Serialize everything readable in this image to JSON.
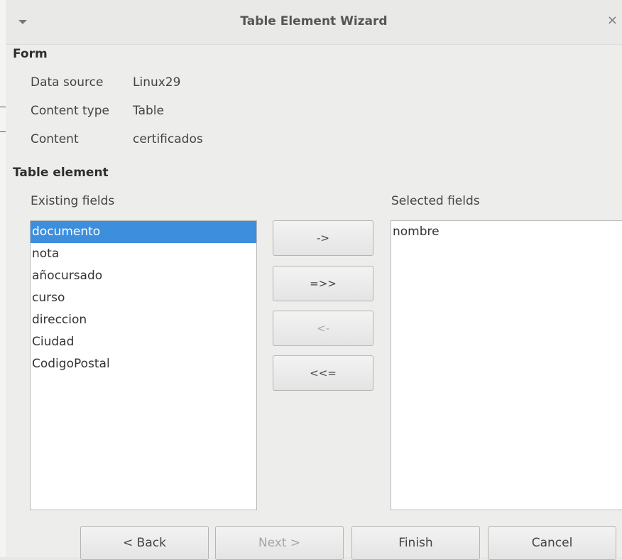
{
  "window": {
    "title": "Table Element Wizard",
    "close_glyph": "×"
  },
  "form": {
    "heading": "Form",
    "rows": [
      {
        "label": "Data source",
        "value": "Linux29"
      },
      {
        "label": "Content type",
        "value": "Table"
      },
      {
        "label": "Content",
        "value": "certificados"
      }
    ]
  },
  "table_element": {
    "heading": "Table element",
    "existing_label": "Existing fields",
    "selected_label": "Selected fields",
    "existing_fields": [
      "documento",
      "nota",
      "añocursado",
      "curso",
      "direccion",
      "Ciudad",
      "CodigoPostal"
    ],
    "existing_selected_index": 0,
    "selected_fields": [
      "nombre"
    ]
  },
  "move_buttons": [
    {
      "label": "->",
      "enabled": true
    },
    {
      "label": "=>>",
      "enabled": true
    },
    {
      "label": "<-",
      "enabled": false
    },
    {
      "label": "<<=",
      "enabled": true
    }
  ],
  "footer": {
    "back": "< Back",
    "next": "Next >",
    "finish": "Finish",
    "cancel": "Cancel"
  },
  "colors": {
    "selection": "#3d8fde",
    "window_bg": "#ededec"
  },
  "icons": [
    "menu-triangle-icon",
    "close-icon"
  ]
}
